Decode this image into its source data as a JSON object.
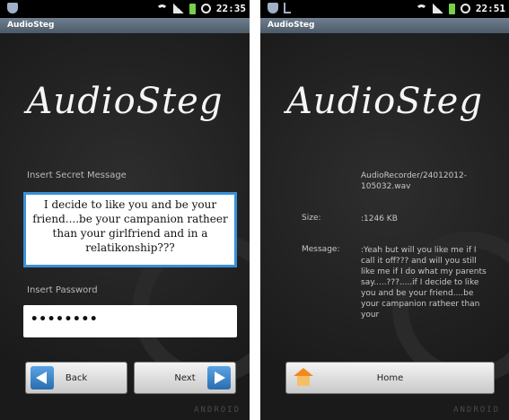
{
  "left_screen": {
    "status": {
      "time": "22:35"
    },
    "app_bar_title": "AudioSteg",
    "logo_text": "AudioSteg",
    "message_label": "Insert Secret Message",
    "message_value": "I decide to like you and be your friend....be your campanion ratheer than your girlfriend and in a relatikonship???",
    "password_label": "Insert Password",
    "password_value": "••••••••",
    "back_label": "Back",
    "next_label": "Next",
    "footer_brand": "ANDROID"
  },
  "right_screen": {
    "status": {
      "time": "22:51"
    },
    "app_bar_title": "AudioSteg",
    "logo_text": "AudioSteg",
    "file_path": "AudioRecorder/24012012-105032.wav",
    "size_label": "Size:",
    "size_value": ":1246 KB",
    "message_label": "Message:",
    "message_value": ":Yeah but will you like me if I call it off??? and will you still like me if I do what my parents say.....???.....if I decide to like you and be your friend....be your campanion ratheer than your",
    "home_label": "Home",
    "footer_brand": "ANDROID"
  },
  "icons": {
    "status_left": [
      "shield-icon"
    ],
    "status_right_left_screen": [
      "wifi-icon",
      "signal-icon",
      "battery-icon",
      "alarm-icon"
    ],
    "status_right_right_screen": [
      "shield-icon",
      "usb-icon",
      "wifi-icon",
      "signal-icon",
      "battery-icon",
      "alarm-icon"
    ]
  },
  "colors": {
    "accent_blue": "#3a90d8",
    "background": "#1c1c1c",
    "home_orange": "#f08a20"
  }
}
